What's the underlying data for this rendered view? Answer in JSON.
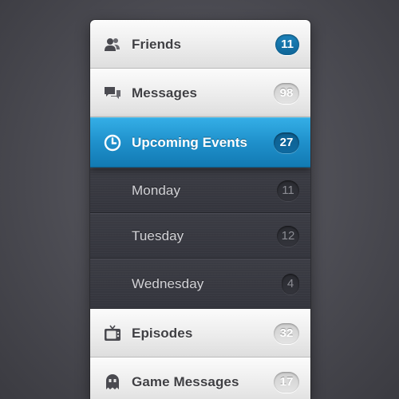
{
  "menu": {
    "friends": {
      "label": "Friends",
      "count": "11",
      "icon": "friends-icon"
    },
    "messages": {
      "label": "Messages",
      "count": "98",
      "icon": "speech-bubbles-icon"
    },
    "upcoming_events": {
      "label": "Upcoming Events",
      "count": "27",
      "icon": "clock-icon"
    },
    "days": [
      {
        "label": "Monday",
        "count": "11"
      },
      {
        "label": "Tuesday",
        "count": "12"
      },
      {
        "label": "Wednesday",
        "count": "4"
      }
    ],
    "episodes": {
      "label": "Episodes",
      "count": "32",
      "icon": "tv-icon"
    },
    "game_messages": {
      "label": "Game Messages",
      "count": "17",
      "icon": "ghost-icon"
    }
  },
  "colors": {
    "accent": "#1f90cb",
    "badge_blue": "#0f6597",
    "light_row": "#ececec",
    "dark_row": "#35363e",
    "background": "#4b4b52"
  }
}
